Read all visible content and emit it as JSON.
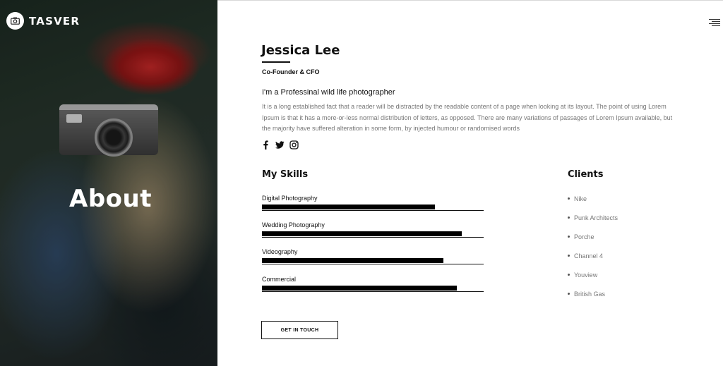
{
  "brand": {
    "logo_text": "TASVER",
    "logo_icon": "camera-icon"
  },
  "hero": {
    "title": "About"
  },
  "menu": {
    "icon": "hamburger-menu-icon"
  },
  "profile": {
    "name": "Jessica Lee",
    "role": "Co-Founder & CFO",
    "tagline": "I'm a Professinal wild life photographer",
    "bio": "It is a long established fact that a reader will be distracted by the readable content of a page when looking at its layout. The point of using Lorem Ipsum is that it has a more-or-less normal distribution of letters, as opposed. There are many variations of passages of Lorem Ipsum available, but the majority have suffered alteration in some form, by injected humour or randomised words",
    "socials": [
      "facebook-icon",
      "twitter-icon",
      "instagram-icon"
    ]
  },
  "skills": {
    "title": "My Skills",
    "items": [
      {
        "label": "Digital Photography",
        "level": 0.78
      },
      {
        "label": "Wedding Photography",
        "level": 0.9
      },
      {
        "label": "Videography",
        "level": 0.82
      },
      {
        "label": "Commercial",
        "level": 0.88
      }
    ]
  },
  "clients": {
    "title": "Clients",
    "items": [
      "Nike",
      "Punk Architects",
      "Porche",
      "Channel 4",
      "Youview",
      "British Gas"
    ]
  },
  "cta": {
    "label": "GET IN TOUCH"
  },
  "colors": {
    "accent": "#000000",
    "muted_text": "#777777",
    "hat_red": "#b8262a"
  }
}
